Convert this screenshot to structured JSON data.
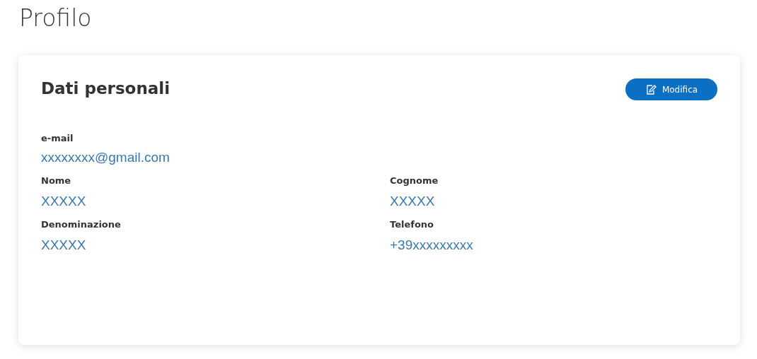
{
  "page_title": "Profilo",
  "card": {
    "title": "Dati personali",
    "edit_button": "Modifica",
    "fields": [
      {
        "label": "e-mail",
        "value": "xxxxxxxx@gmail.com",
        "kind": "wide"
      },
      {
        "label": "Nome",
        "value": "XXXXX",
        "kind": "half"
      },
      {
        "label": "Cognome",
        "value": "XXXXX",
        "kind": "half"
      },
      {
        "label": "Denominazione",
        "value": "XXXXX",
        "kind": "half"
      },
      {
        "label": "Telefono",
        "value": "+39xxxxxxxxx",
        "kind": "half"
      }
    ]
  }
}
